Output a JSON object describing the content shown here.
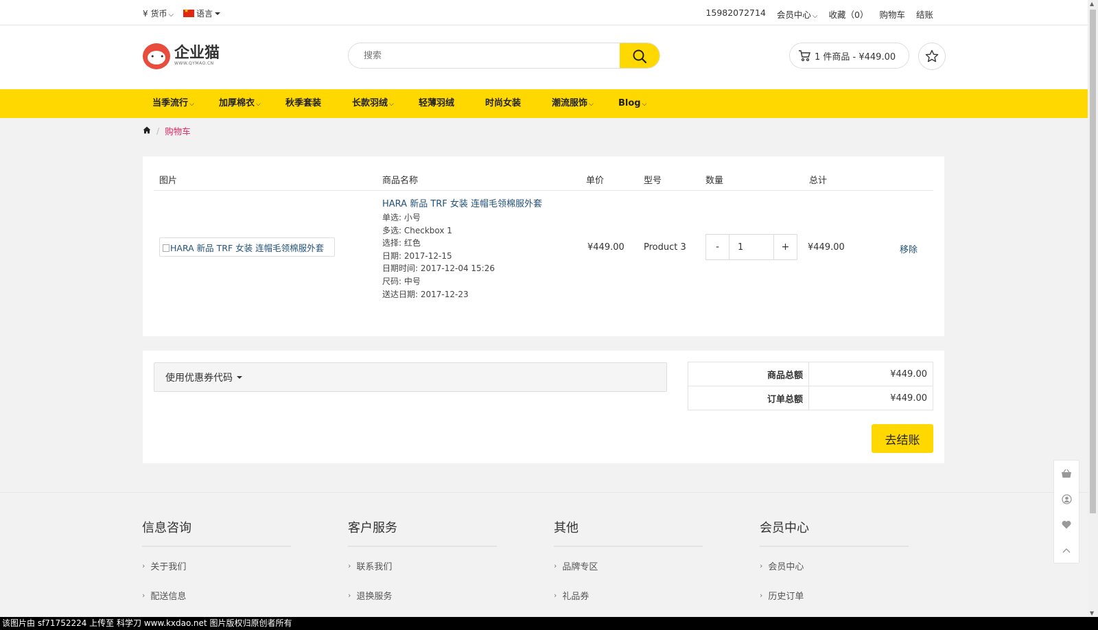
{
  "topbar": {
    "currency": "¥ 货币",
    "language": "语言",
    "phone": "15982072714",
    "member": "会员中心",
    "favorites": "收藏（0）",
    "cart": "购物车",
    "checkout": "结账"
  },
  "header": {
    "logo_text": "企业猫",
    "logo_sub": "WWW.QYMAO.CN",
    "search_placeholder": "搜索",
    "cart_summary": "1 件商品 - ¥449.00"
  },
  "nav": {
    "items": [
      {
        "label": "当季流行",
        "dropdown": true
      },
      {
        "label": "加厚棉衣",
        "dropdown": true
      },
      {
        "label": "秋季套装",
        "dropdown": false
      },
      {
        "label": "长款羽绒",
        "dropdown": true
      },
      {
        "label": "轻薄羽绒",
        "dropdown": false
      },
      {
        "label": "时尚女装",
        "dropdown": false
      },
      {
        "label": "潮流服饰",
        "dropdown": true
      },
      {
        "label": "Blog",
        "dropdown": true
      }
    ]
  },
  "breadcrumb": {
    "current": "购物车"
  },
  "cart": {
    "headers": {
      "image": "图片",
      "name": "商品名称",
      "price": "单价",
      "model": "型号",
      "quantity": "数量",
      "total": "总计"
    },
    "item": {
      "image_alt": "HARA 新品 TRF 女装 连帽毛领棉服外套",
      "name": "HARA 新品 TRF 女装 连帽毛领棉服外套",
      "options": [
        "单选: 小号",
        "多选: Checkbox 1",
        "选择: 红色",
        "日期: 2017-12-15",
        "日期时间: 2017-12-04 15:26",
        "尺码: 中号",
        "送达日期: 2017-12-23"
      ],
      "price": "¥449.00",
      "model": "Product 3",
      "qty_minus": "-",
      "qty": "1",
      "qty_plus": "+",
      "total": "¥449.00",
      "remove": "移除"
    }
  },
  "totals": {
    "coupon": "使用优惠券代码",
    "subtotal_label": "商品总额",
    "subtotal": "¥449.00",
    "order_total_label": "订单总额",
    "order_total": "¥449.00",
    "checkout_button": "去结账"
  },
  "footer": {
    "columns": [
      {
        "title": "信息咨询",
        "links": [
          "关于我们",
          "配送信息"
        ]
      },
      {
        "title": "客户服务",
        "links": [
          "联系我们",
          "退换服务"
        ]
      },
      {
        "title": "其他",
        "links": [
          "品牌专区",
          "礼品券"
        ]
      },
      {
        "title": "会员中心",
        "links": [
          "会员中心",
          "历史订单"
        ]
      }
    ]
  },
  "watermark": "该图片由 sf71752224 上传至 科学刀 www.kxdao.net 图片版权归原创者所有",
  "colors": {
    "accent": "#ffd800",
    "link": "#23527c",
    "breadcrumb_active": "#e0245e"
  }
}
